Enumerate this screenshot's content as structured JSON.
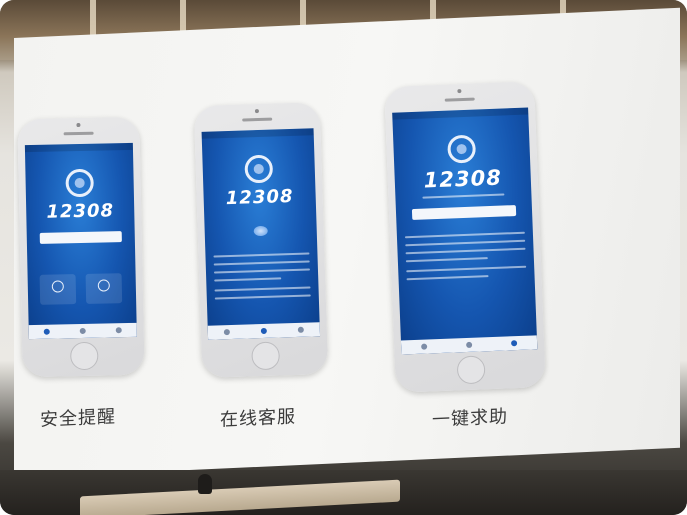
{
  "photo": {
    "screen_color": "#f3f3f1",
    "app_blue": "#1556b0"
  },
  "slides": [
    {
      "caption": "安全提醒",
      "app_number": "12308",
      "screen": "home-screen",
      "tiles": [
        "shield-icon",
        "person-icon"
      ]
    },
    {
      "caption": "在线客服",
      "app_number": "12308",
      "screen": "chat-screen"
    },
    {
      "caption": "一键求助",
      "app_number": "12308",
      "screen": "help-screen"
    }
  ]
}
